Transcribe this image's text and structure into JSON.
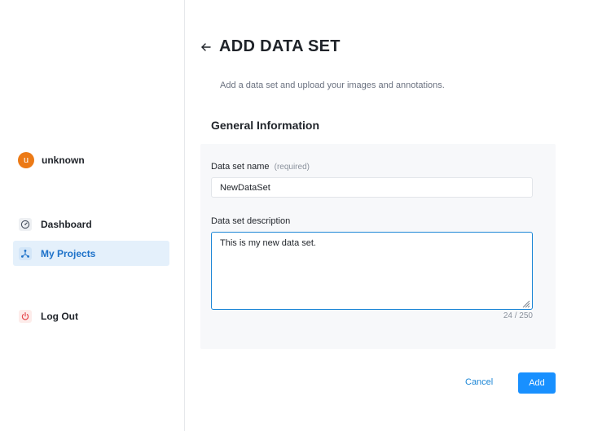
{
  "user": {
    "avatar_letter": "u",
    "name": "unknown"
  },
  "nav": {
    "items": [
      {
        "label": "Dashboard",
        "icon": "dashboard-gauge-icon",
        "active": false
      },
      {
        "label": "My Projects",
        "icon": "projects-network-icon",
        "active": true
      },
      {
        "label": "Log Out",
        "icon": "power-icon",
        "active": false
      }
    ]
  },
  "header": {
    "title": "ADD DATA SET",
    "subtitle": "Add a data set and upload your images and annotations."
  },
  "section": {
    "title": "General Information"
  },
  "form": {
    "name_label": "Data set name",
    "name_required": "(required)",
    "name_value": "NewDataSet",
    "description_label": "Data set description",
    "description_value": "This is my new data set.",
    "char_count": "24 / 250"
  },
  "actions": {
    "cancel_label": "Cancel",
    "add_label": "Add"
  },
  "colors": {
    "accent": "#1890ff",
    "active_nav_bg": "#e4f0fb",
    "avatar": "#ec7a16",
    "logout_icon": "#e5484d"
  }
}
